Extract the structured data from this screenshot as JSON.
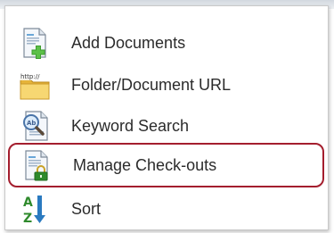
{
  "menu": {
    "items": [
      {
        "label": "Add Documents",
        "icon": "add-document-icon"
      },
      {
        "label": "Folder/Document URL",
        "icon": "folder-url-icon",
        "icon_text": "http://"
      },
      {
        "label": "Keyword Search",
        "icon": "keyword-search-icon"
      },
      {
        "label": "Manage Check-outs",
        "icon": "manage-checkouts-icon",
        "highlighted": true
      },
      {
        "label": "Sort",
        "icon": "sort-icon"
      }
    ]
  },
  "colors": {
    "highlight_border": "#a41e2e",
    "text": "#2b2b2b",
    "plus_green": "#3e9e2f",
    "folder_yellow": "#f2c94c",
    "lock_green": "#2f8a2c"
  }
}
